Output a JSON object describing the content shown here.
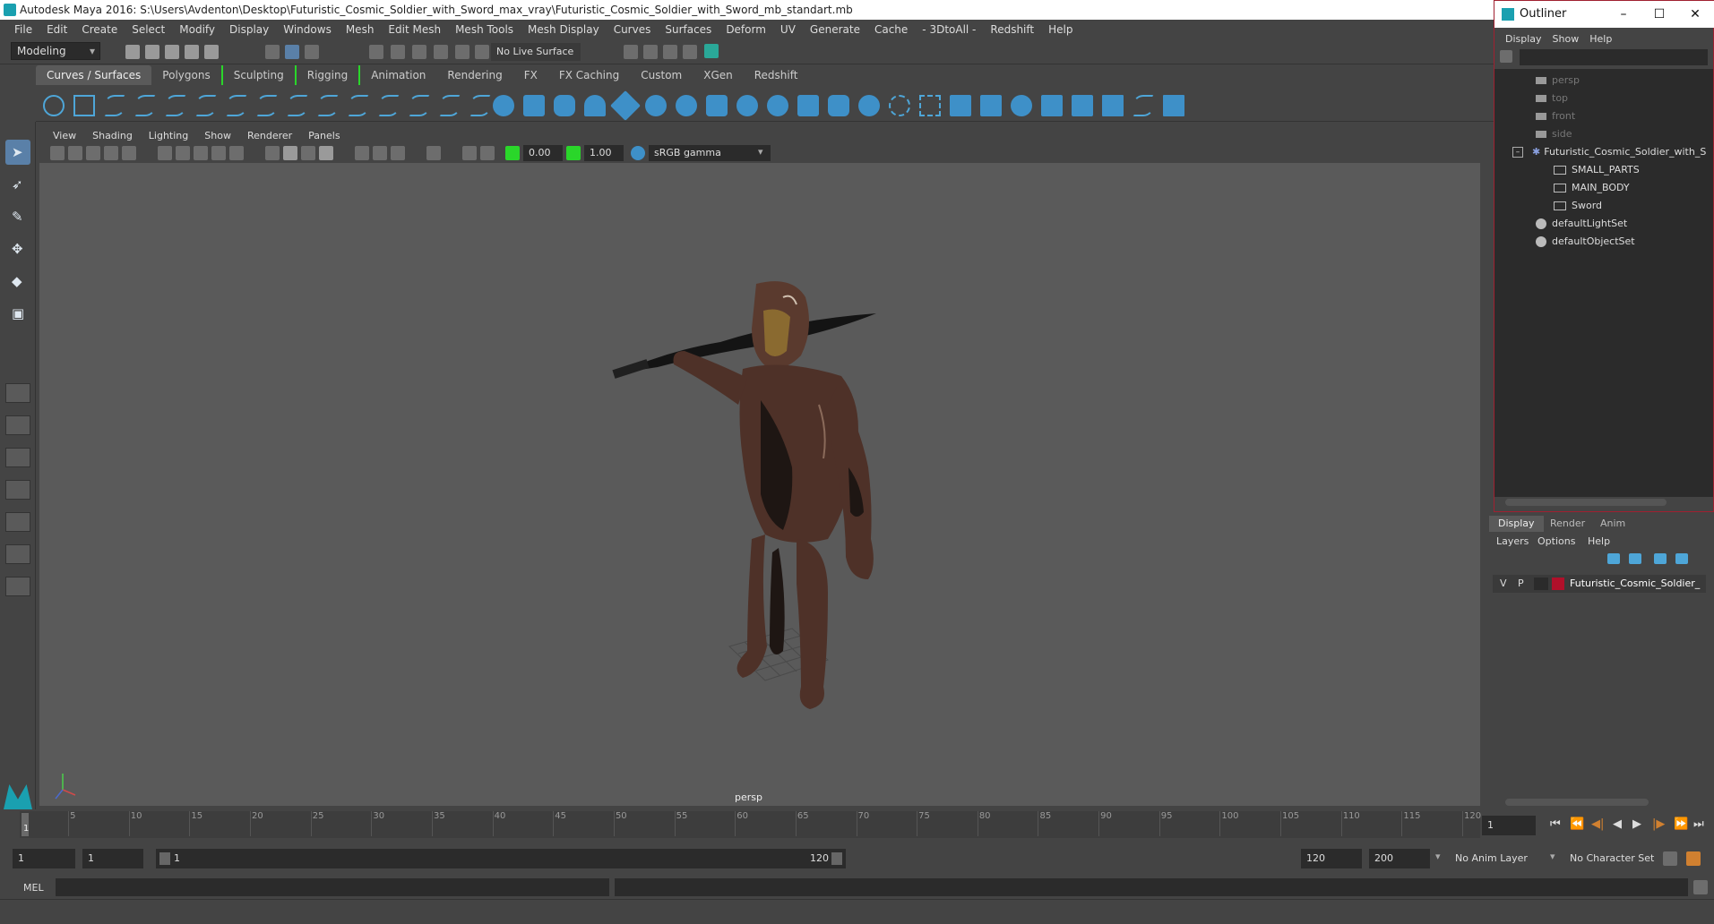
{
  "window": {
    "title": "Autodesk Maya 2016: S:\\Users\\Avdenton\\Desktop\\Futuristic_Cosmic_Soldier_with_Sword_max_vray\\Futuristic_Cosmic_Soldier_with_Sword_mb_standart.mb"
  },
  "menubar": [
    "File",
    "Edit",
    "Create",
    "Select",
    "Modify",
    "Display",
    "Windows",
    "Mesh",
    "Edit Mesh",
    "Mesh Tools",
    "Mesh Display",
    "Curves",
    "Surfaces",
    "Deform",
    "UV",
    "Generate",
    "Cache",
    "- 3DtoAll -",
    "Redshift",
    "Help"
  ],
  "statusline": {
    "mode": "Modeling",
    "live_surface": "No Live Surface"
  },
  "shelf_tabs": [
    "Curves / Surfaces",
    "Polygons",
    "Sculpting",
    "Rigging",
    "Animation",
    "Rendering",
    "FX",
    "FX Caching",
    "Custom",
    "XGen",
    "Redshift"
  ],
  "viewport": {
    "menu": [
      "View",
      "Shading",
      "Lighting",
      "Show",
      "Renderer",
      "Panels"
    ],
    "exposure": "0.00",
    "gamma": "1.00",
    "color_space": "sRGB gamma",
    "camera_label": "persp"
  },
  "outliner": {
    "title": "Outliner",
    "menu": [
      "Display",
      "Show",
      "Help"
    ],
    "items": [
      {
        "label": "persp",
        "kind": "camera",
        "dim": true
      },
      {
        "label": "top",
        "kind": "camera",
        "dim": true
      },
      {
        "label": "front",
        "kind": "camera",
        "dim": true
      },
      {
        "label": "side",
        "kind": "camera",
        "dim": true
      },
      {
        "label": "Futuristic_Cosmic_Soldier_with_S",
        "kind": "group",
        "dim": false
      },
      {
        "label": "SMALL_PARTS",
        "kind": "mesh",
        "dim": false
      },
      {
        "label": "MAIN_BODY",
        "kind": "mesh",
        "dim": false
      },
      {
        "label": "Sword",
        "kind": "mesh",
        "dim": false
      },
      {
        "label": "defaultLightSet",
        "kind": "set",
        "dim": false
      },
      {
        "label": "defaultObjectSet",
        "kind": "set",
        "dim": false
      }
    ]
  },
  "layer_panel": {
    "tabs": [
      "Display",
      "Render",
      "Anim"
    ],
    "menu": [
      "Layers",
      "Options",
      "Help"
    ],
    "layer": {
      "v": "V",
      "p": "P",
      "name": "Futuristic_Cosmic_Soldier_",
      "color": "#b0102a"
    }
  },
  "timeline": {
    "ticks": [
      "5",
      "10",
      "15",
      "20",
      "25",
      "30",
      "35",
      "40",
      "45",
      "50",
      "55",
      "60",
      "65",
      "70",
      "75",
      "80",
      "85",
      "90",
      "95",
      "100",
      "105",
      "110",
      "115",
      "120"
    ],
    "current_frame_marker": "1",
    "current_frame_field": "1"
  },
  "range": {
    "start": "1",
    "anim_start": "1",
    "slider_start": "1",
    "slider_end": "120",
    "anim_end_a": "120",
    "anim_end_b": "200",
    "anim_layer": "No Anim Layer",
    "character_set": "No Character Set"
  },
  "command_line": {
    "label": "MEL"
  },
  "colors": {
    "accent": "#5a80a8",
    "shelf_icon": "#4ea6d8",
    "layer_red": "#b0102a",
    "green_bracket": "#2ad62a"
  }
}
